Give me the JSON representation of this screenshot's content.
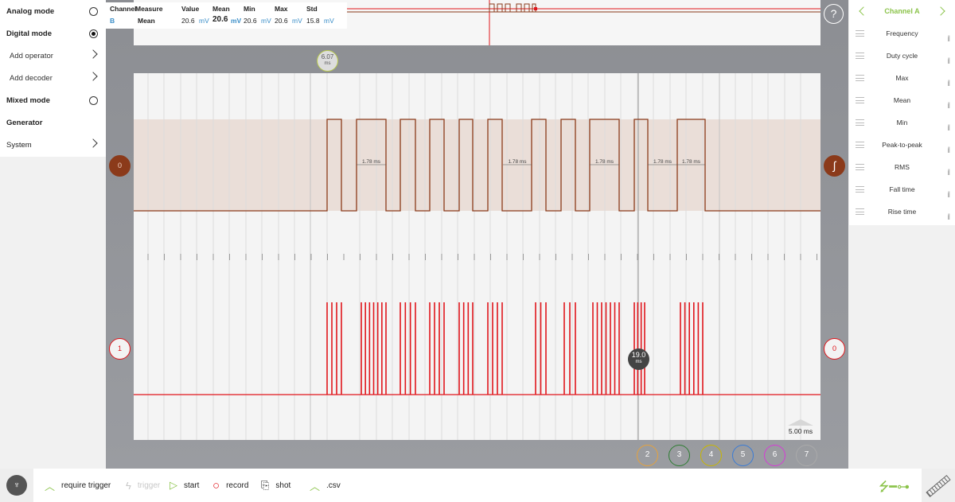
{
  "left_menu": [
    {
      "label": "Analog mode",
      "style": "bold",
      "control": "radio",
      "checked": false
    },
    {
      "label": "Digital mode",
      "style": "bold",
      "control": "radio",
      "checked": true
    },
    {
      "label": "Add operator",
      "style": "sub",
      "control": "chevron"
    },
    {
      "label": "Add decoder",
      "style": "sub",
      "control": "chevron"
    },
    {
      "label": "Mixed mode",
      "style": "bold",
      "control": "radio",
      "checked": false
    },
    {
      "label": "Generator",
      "style": "bold",
      "control": "none"
    },
    {
      "label": "System",
      "style": "plain",
      "control": "chevron"
    }
  ],
  "measure_table": {
    "headers": [
      "Channel",
      "Measure",
      "Value",
      "Mean",
      "Min",
      "Max",
      "Std"
    ],
    "row": {
      "channel": "B",
      "measure": "Mean",
      "value": "20.6",
      "value_unit": "mV",
      "mean": "20.6",
      "mean_unit": "mV",
      "min": "20.6",
      "min_unit": "mV",
      "max": "20.6",
      "max_unit": "mV",
      "std": "15.8",
      "std_unit": "mV"
    }
  },
  "help_label": "?",
  "cursor": {
    "value": "6.07",
    "unit": "ms"
  },
  "time_marker": {
    "value": "19.0",
    "unit": "ms"
  },
  "timebase_label": "5.00 ms",
  "channel0": {
    "left_marker": "0",
    "pulse_width_label": "1.78 ms",
    "color": "#8b3a1a"
  },
  "channel1": {
    "left_marker": "1",
    "right_marker": "0",
    "color": "#e0151b"
  },
  "channel_buttons": [
    {
      "label": "2",
      "color": "#e6a23c"
    },
    {
      "label": "3",
      "color": "#2e7d32"
    },
    {
      "label": "4",
      "color": "#c8b600"
    },
    {
      "label": "5",
      "color": "#3a7bd5"
    },
    {
      "label": "6",
      "color": "#d63bd6"
    },
    {
      "label": "7",
      "color": "#aaaaaa"
    }
  ],
  "right_panel": {
    "title": "Channel A",
    "items": [
      "Frequency",
      "Duty cycle",
      "Max",
      "Mean",
      "Min",
      "Peak-to-peak",
      "RMS",
      "Fall time",
      "Rise time"
    ]
  },
  "bottom_bar": {
    "require_trigger": "require trigger",
    "trigger": "trigger",
    "start": "start",
    "record": "record",
    "shot": "shot",
    "csv": ".csv"
  },
  "colors": {
    "accent": "#8bc34a",
    "plot_bg": "#f4f4f4",
    "frame_bg": "#8e9095"
  }
}
